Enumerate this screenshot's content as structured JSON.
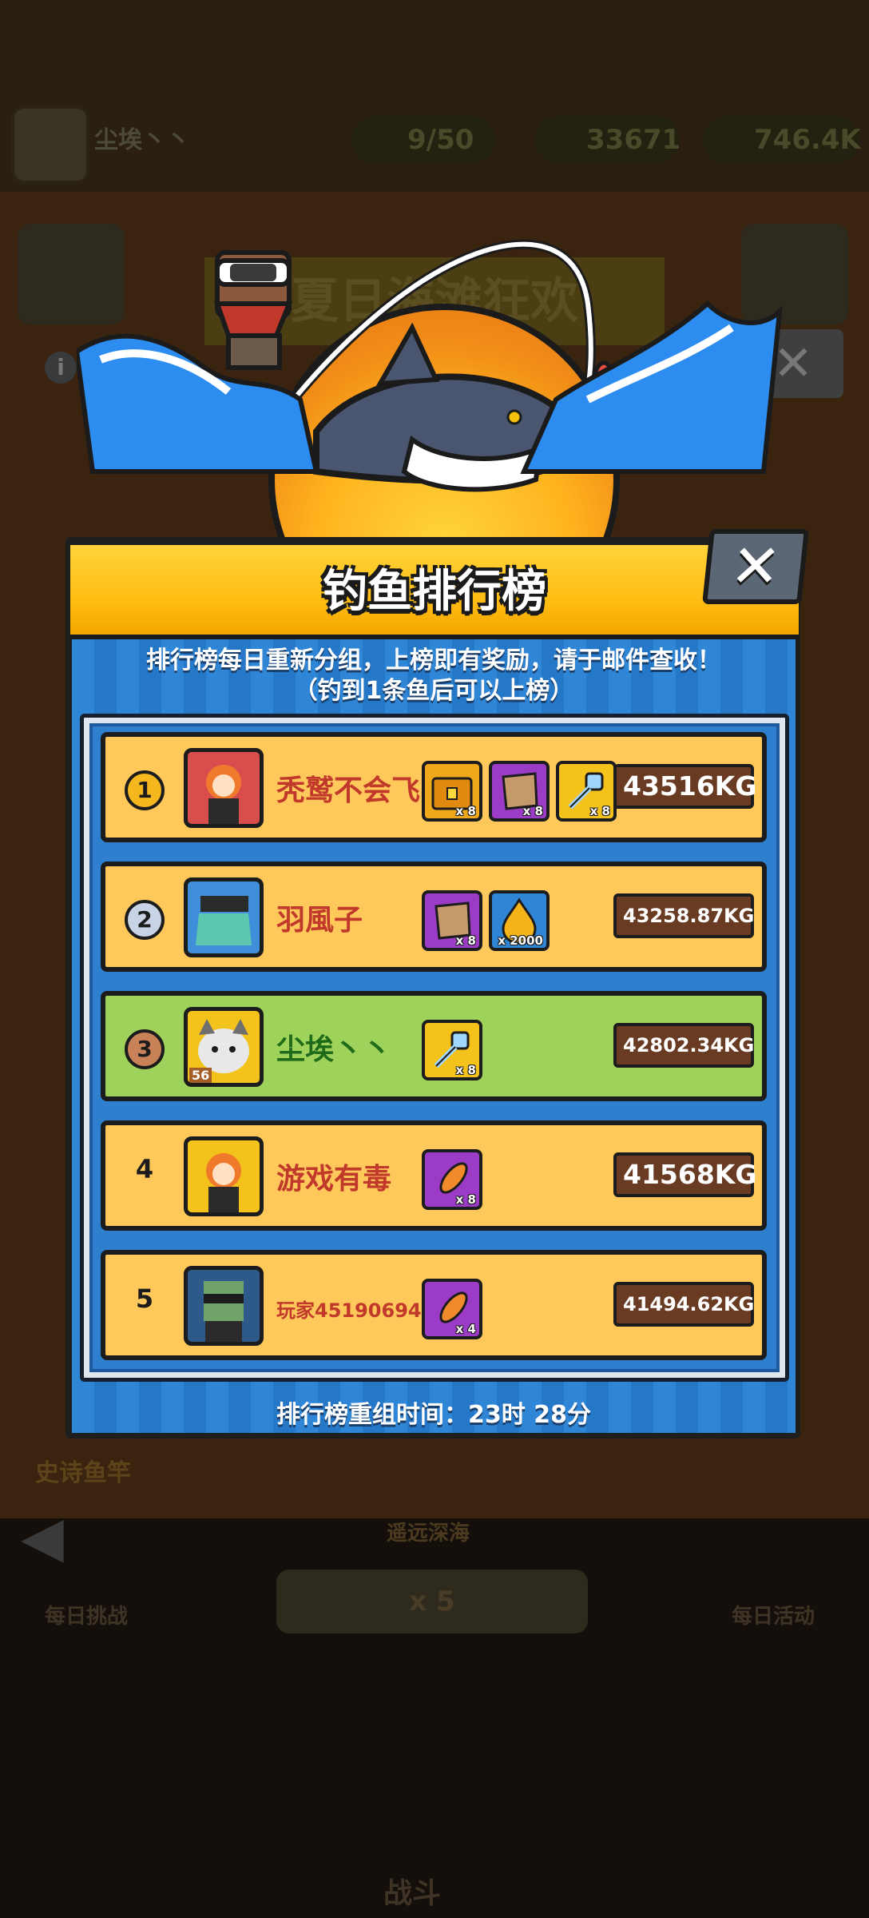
{
  "background": {
    "player_name": "尘埃丶丶",
    "energy": "9/50",
    "currency_1": "33671",
    "currency_2": "746.4K",
    "event_banner": "夏日海滩狂欢",
    "rod_label": "史诗鱼竿",
    "location_label": "遥远深海",
    "multiplier": "x 5",
    "daily_challenge": "每日挑战",
    "daily_event": "每日活动",
    "battle_tab": "战斗"
  },
  "panel": {
    "title": "钓鱼排行榜",
    "close_label": "✕",
    "notice_line1": "排行榜每日重新分组，上榜即有奖励，请于邮件查收！",
    "notice_line2": "（钓到1条鱼后可以上榜）",
    "reset_text": "排行榜重组时间：23时 28分"
  },
  "leaderboard": [
    {
      "rank": "1",
      "name": "秃鹫不会飞",
      "score": "43516KG",
      "rewards": [
        {
          "icon": "treasure-chest-icon",
          "count": "x 8"
        },
        {
          "icon": "map-fragment-icon",
          "count": "x 8"
        },
        {
          "icon": "key-icon",
          "count": "x 8"
        }
      ]
    },
    {
      "rank": "2",
      "name": "羽風子",
      "score": "43258.87KG",
      "rewards": [
        {
          "icon": "map-fragment-icon",
          "count": "x 8"
        },
        {
          "icon": "gold-drop-icon",
          "count": "x 2000"
        }
      ]
    },
    {
      "rank": "3",
      "name": "尘埃丶丶",
      "score": "42802.34KG",
      "level": "56",
      "rewards": [
        {
          "icon": "key-icon",
          "count": "x 8"
        }
      ]
    },
    {
      "rank": "4",
      "name": "游戏有毒",
      "score": "41568KG",
      "rewards": [
        {
          "icon": "fishing-lure-icon",
          "count": "x 8"
        }
      ]
    },
    {
      "rank": "5",
      "name": "玩家45190694",
      "score": "41494.62KG",
      "rewards": [
        {
          "icon": "fishing-lure-icon",
          "count": "x 4"
        }
      ]
    }
  ],
  "colors": {
    "row_default": "#ffc85a",
    "row_self": "#9fd25a",
    "name_default": "#c0392b",
    "name_self": "#1f6b1a",
    "header": "#ffbd14",
    "panel_blue": "#2f86d6"
  }
}
